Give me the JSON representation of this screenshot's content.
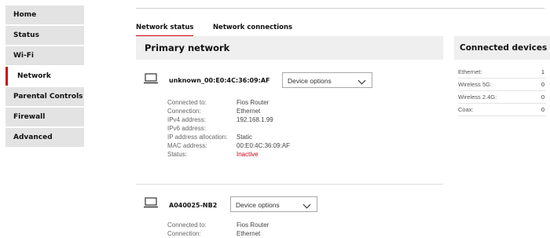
{
  "sidebar": {
    "items": [
      {
        "label": "Home"
      },
      {
        "label": "Status"
      },
      {
        "label": "Wi-Fi"
      },
      {
        "label": "Network",
        "active": true
      },
      {
        "label": "Parental Controls"
      },
      {
        "label": "Firewall"
      },
      {
        "label": "Advanced"
      }
    ]
  },
  "tabs": [
    {
      "label": "Network status",
      "active": true
    },
    {
      "label": "Network connections"
    }
  ],
  "primary": {
    "title": "Primary network",
    "devices": [
      {
        "icon": "laptop-icon",
        "name": "unknown_00:E0:4C:36:09:AF",
        "options_label": "Device options",
        "connected_to_label": "Connected to:",
        "connected_to": "Fios Router",
        "connection_label": "Connection:",
        "connection": "Ethernet",
        "ipv4_label": "IPv4 address:",
        "ipv4": "192.168.1.99",
        "ipv6_label": "IPv6 address:",
        "ipv6": "",
        "ip_alloc_label": "IP address allocation:",
        "ip_alloc": "Static",
        "mac_label": "MAC address:",
        "mac": "00:E0:4C:36:09:AF",
        "status_label": "Status:",
        "status": "Inactive"
      },
      {
        "icon": "laptop-icon",
        "name": "A040025-NB2",
        "options_label": "Device options",
        "connected_to_label": "Connected to:",
        "connected_to": "Fios Router",
        "connection_label": "Connection:",
        "connection": "Ethernet"
      }
    ]
  },
  "connected": {
    "title": "Connected devices",
    "rows": [
      {
        "label": "Ethernet:",
        "count": "1"
      },
      {
        "label": "Wireless 5G:",
        "count": "0"
      },
      {
        "label": "Wireless 2.4G:",
        "count": "0"
      },
      {
        "label": "Coax:",
        "count": "0"
      }
    ]
  },
  "colors": {
    "accent": "#cd040b",
    "inactive": "#d0021b",
    "panel_bg": "#efefef",
    "nav_bg": "#e3e3e3"
  }
}
